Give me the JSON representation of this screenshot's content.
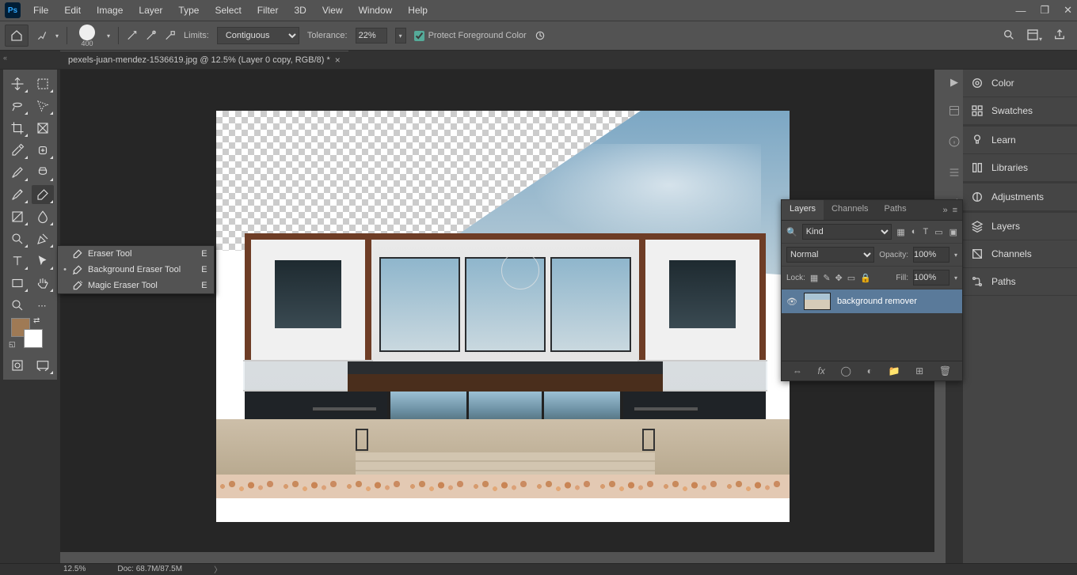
{
  "menu": [
    "File",
    "Edit",
    "Image",
    "Layer",
    "Type",
    "Select",
    "Filter",
    "3D",
    "View",
    "Window",
    "Help"
  ],
  "doc_tab": {
    "title": "pexels-juan-mendez-1536619.jpg @ 12.5% (Layer 0 copy, RGB/8) *"
  },
  "options": {
    "brush_size": "400",
    "limits_label": "Limits:",
    "limits_value": "Contiguous",
    "tolerance_label": "Tolerance:",
    "tolerance_value": "22%",
    "protect_fg": "Protect Foreground Color"
  },
  "flyout": [
    {
      "label": "Eraser Tool",
      "key": "E",
      "active": false
    },
    {
      "label": "Background Eraser Tool",
      "key": "E",
      "active": true
    },
    {
      "label": "Magic Eraser Tool",
      "key": "E",
      "active": false
    }
  ],
  "right_tabs": [
    "Color",
    "Swatches",
    "Learn",
    "Libraries",
    "Adjustments",
    "Layers",
    "Channels",
    "Paths"
  ],
  "layers_panel": {
    "tabs": [
      "Layers",
      "Channels",
      "Paths"
    ],
    "kind": "Kind",
    "blend": "Normal",
    "opacity_label": "Opacity:",
    "opacity": "100%",
    "lock_label": "Lock:",
    "fill_label": "Fill:",
    "fill": "100%",
    "layers": [
      {
        "name": "background remover"
      }
    ]
  },
  "status": {
    "zoom": "12.5%",
    "doc": "Doc: 68.7M/87.5M"
  },
  "colors": {
    "fg": "#9f7a55",
    "bg": "#ffffff"
  }
}
